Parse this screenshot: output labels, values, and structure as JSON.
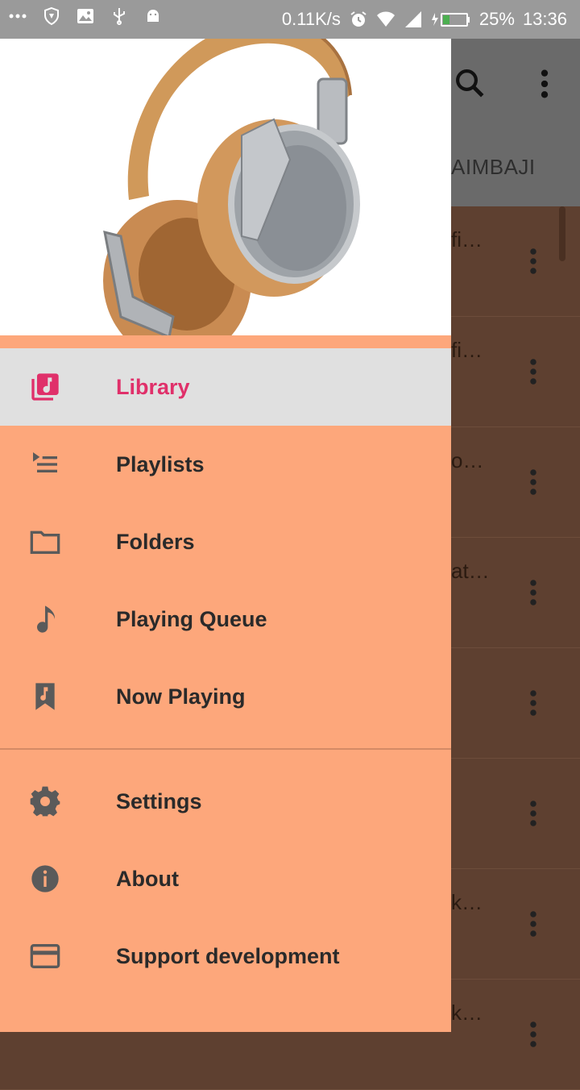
{
  "status_bar": {
    "speed": "0.11K/s",
    "battery": "25%",
    "time": "13:36"
  },
  "background": {
    "tab_partial": "AIMBAJI",
    "rows": [
      "fi…",
      "fi…",
      "o…",
      "at…",
      "",
      "",
      "k…",
      "k…"
    ]
  },
  "drawer": {
    "items": [
      {
        "label": "Library",
        "icon": "library-music-icon"
      },
      {
        "label": "Playlists",
        "icon": "playlist-play-icon"
      },
      {
        "label": "Folders",
        "icon": "folder-icon"
      },
      {
        "label": "Playing Queue",
        "icon": "music-note-icon"
      },
      {
        "label": "Now Playing",
        "icon": "music-bookmark-icon"
      }
    ],
    "secondary": [
      {
        "label": "Settings",
        "icon": "gear-icon"
      },
      {
        "label": "About",
        "icon": "info-icon"
      },
      {
        "label": "Support development",
        "icon": "credit-card-icon"
      }
    ]
  },
  "colors": {
    "drawer_bg": "#fda77b",
    "accent": "#e0306a",
    "selected_bg": "#e0e0e0"
  }
}
